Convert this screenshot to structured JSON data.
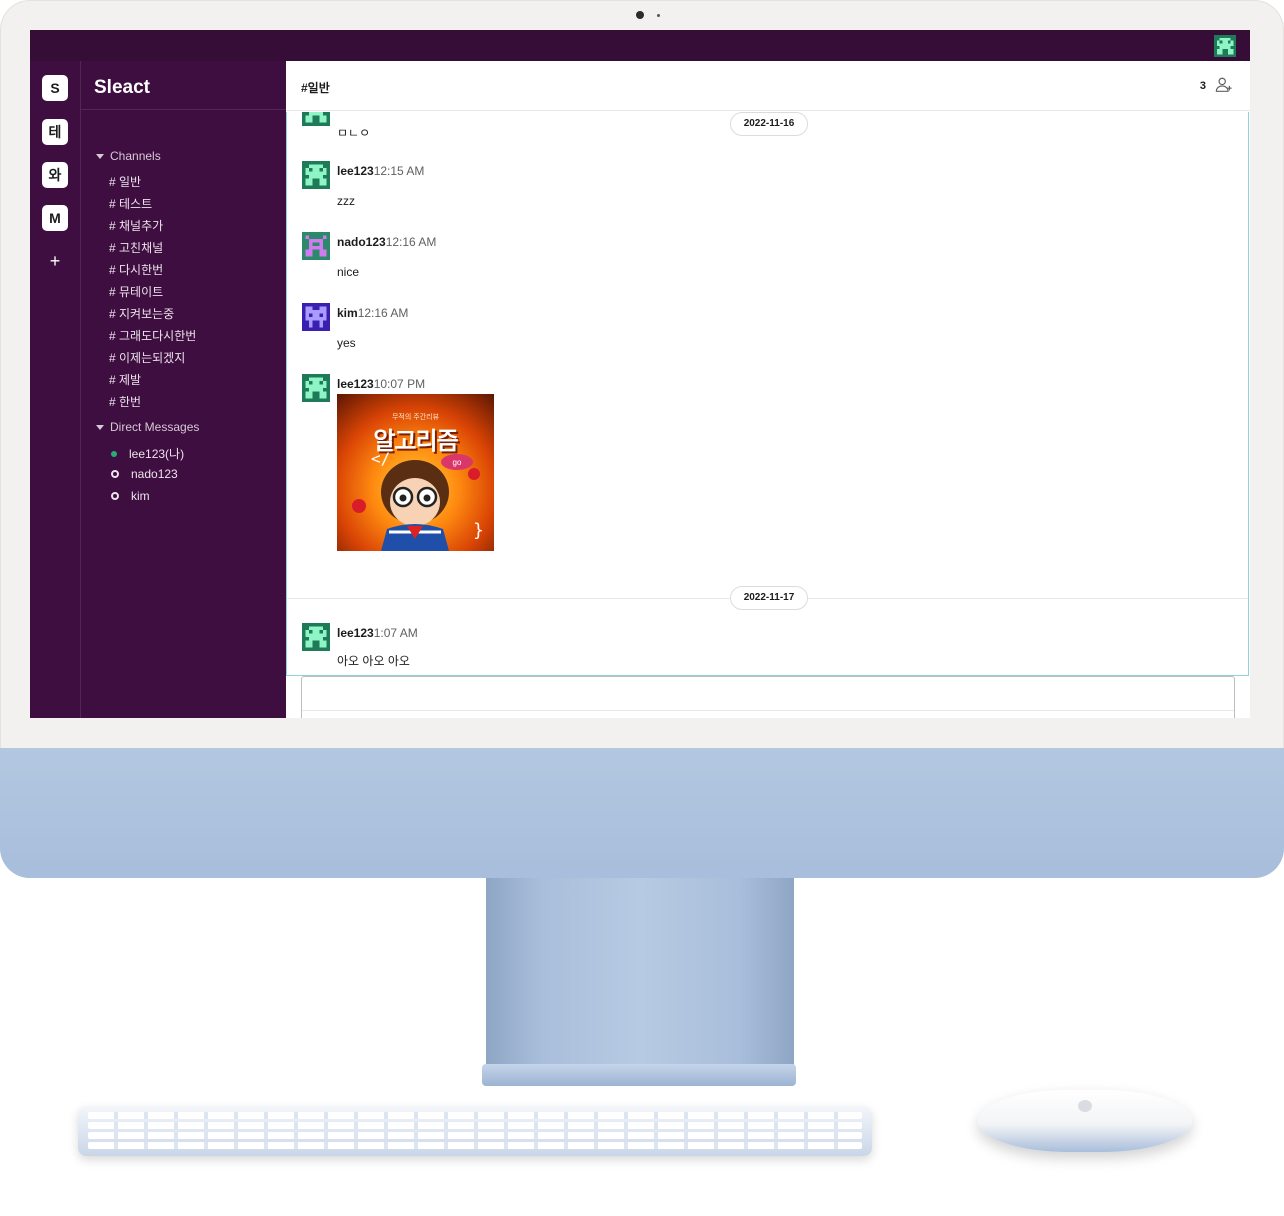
{
  "workspaces": [
    {
      "label": "S"
    },
    {
      "label": "테"
    },
    {
      "label": "와"
    },
    {
      "label": "M"
    }
  ],
  "add_workspace": "+",
  "workspace_name": "Sleact",
  "channels_section": "Channels",
  "channels": [
    "# 일반",
    "# 테스트",
    "# 채널추가",
    "# 고친채널",
    "# 다시한번",
    "# 뮤테이트",
    "# 지켜보는중",
    "# 그래도다시한번",
    "# 이제는되겠지",
    "# 제발",
    "# 한번"
  ],
  "dm_section": "Direct Messages",
  "dms": [
    {
      "name": "lee123(나)",
      "status": "online"
    },
    {
      "name": "nado123",
      "status": "offline"
    },
    {
      "name": "kim",
      "status": "offline"
    }
  ],
  "header": {
    "channel": "#일반",
    "member_count": "3",
    "add_member_icon": "add-member-icon"
  },
  "date_pills": [
    "2022-11-16",
    "2022-11-17"
  ],
  "messages": [
    {
      "text": "ㅁㄴㅇ"
    },
    {
      "nick": "lee123",
      "time": "12:15 AM",
      "text": "zzz"
    },
    {
      "nick": "nado123",
      "time": "12:16 AM",
      "text": "nice"
    },
    {
      "nick": "kim",
      "time": "12:16 AM",
      "text": "yes"
    },
    {
      "nick": "lee123",
      "time": "10:07 PM",
      "image_small": "무적의 주간리뷰",
      "image_title": "알고리즘",
      "image_tag": "go"
    },
    {
      "nick": "lee123",
      "time": "1:07 AM",
      "text": "아오 아오 아오"
    }
  ],
  "colors": {
    "sidebar": "#3f0e40",
    "topbar": "#350d36",
    "avatar_green": "#2fcf8e",
    "avatar_purple": "#b05be0",
    "avatar_blue": "#5a3fd6",
    "chin": "#a7bedc"
  }
}
